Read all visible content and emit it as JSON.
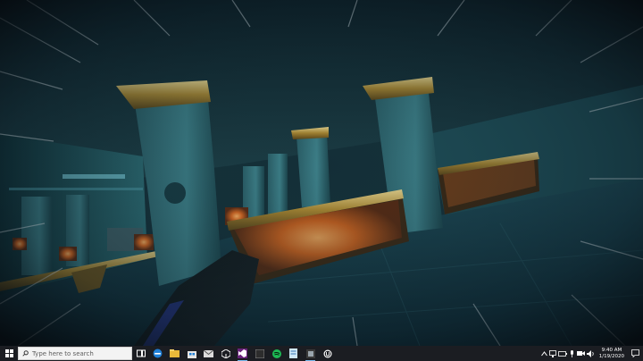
{
  "taskbar": {
    "search_placeholder": "Type here to search",
    "apps": [
      {
        "icon": "task-view-icon"
      },
      {
        "icon": "edge-icon"
      },
      {
        "icon": "file-explorer-icon"
      },
      {
        "icon": "store-icon"
      },
      {
        "icon": "mail-icon"
      },
      {
        "icon": "unity-icon"
      },
      {
        "icon": "visual-studio-icon"
      },
      {
        "icon": "app-icon"
      },
      {
        "icon": "spotify-icon"
      },
      {
        "icon": "notepad-icon"
      },
      {
        "icon": "app-icon"
      },
      {
        "icon": "unreal-engine-icon"
      }
    ],
    "clock_time": "9:40 AM",
    "clock_date": "1/19/2020"
  },
  "colors": {
    "taskbar_bg": "#1b1d22",
    "accent": "#76b9ed",
    "brass": "#c9a24b",
    "lamp": "#e8782a"
  }
}
